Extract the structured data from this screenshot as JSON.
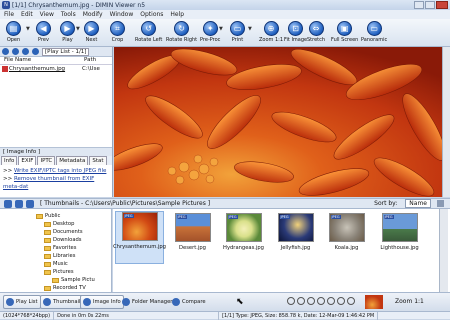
{
  "window": {
    "title": "[1/1] Chrysanthemum.jpg - DIMIN Viewer n5"
  },
  "menu": [
    "File",
    "Edit",
    "View",
    "Tools",
    "Modify",
    "Window",
    "Options",
    "Help"
  ],
  "toolbar": [
    {
      "label": "Open",
      "icon": "folder-icon"
    },
    {
      "label": "Prev",
      "icon": "arrow-left-icon"
    },
    {
      "label": "Play",
      "icon": "play-icon"
    },
    {
      "label": "Next",
      "icon": "arrow-right-icon"
    },
    {
      "label": "Crop",
      "icon": "crop-icon"
    },
    {
      "label": "Rotate Left",
      "icon": "rotate-left-icon"
    },
    {
      "label": "Rotate Right",
      "icon": "rotate-right-icon"
    },
    {
      "label": "Pre-Proc",
      "icon": "preprocess-icon"
    },
    {
      "label": "Print",
      "icon": "print-icon"
    },
    {
      "label": "Zoom 1:1",
      "icon": "zoom-icon"
    },
    {
      "label": "Fit Image",
      "icon": "fit-icon"
    },
    {
      "label": "Stretch",
      "icon": "stretch-icon"
    },
    {
      "label": "Full Screen",
      "icon": "fullscreen-icon"
    },
    {
      "label": "Panoramic",
      "icon": "panoramic-icon"
    }
  ],
  "playlist": {
    "title": "[Play List - 1/1]",
    "col_file": "File Name",
    "col_path": "Path",
    "file": "Chrysanthemum.jpg",
    "path": "C:\\Use"
  },
  "info": {
    "title": "[ Image Info ]",
    "tabs": [
      "Info",
      "EXIF",
      "IPTC",
      "Metadata",
      "Stat"
    ],
    "selected_tab": "EXIF",
    "link1": "Write EXIF/IPTC tags into JPEG file",
    "link2": "Remove thumbnail from EXIF meta-dat"
  },
  "thumbnails": {
    "title": "[ Thumbnails - C:\\Users\\Public\\Pictures\\Sample Pictures ]",
    "sort_label": "Sort by:",
    "sort_value": "Name",
    "items": [
      {
        "name": "Chrysanthemum.jpg",
        "badge": "JPEG"
      },
      {
        "name": "Desert.jpg",
        "badge": "JPEG"
      },
      {
        "name": "Hydrangeas.jpg",
        "badge": "JPEG"
      },
      {
        "name": "Jellyfish.jpg",
        "badge": "JPEG"
      },
      {
        "name": "Koala.jpg",
        "badge": "JPEG"
      },
      {
        "name": "Lighthouse.jpg",
        "badge": "JPEG"
      }
    ]
  },
  "tree": [
    "Public",
    "Desktop",
    "Documents",
    "Downloads",
    "Favorites",
    "Libraries",
    "Music",
    "Pictures",
    "Sample Pictu",
    "Recorded TV"
  ],
  "bottom": {
    "playlist": "Play List",
    "thumbnails": "Thumbnails",
    "image_info": "Image Info",
    "folder_manager": "Folder Manager",
    "compare": "Compare",
    "zoom": "Zoom 1:1"
  },
  "status": {
    "dims": "(1024*768*24bpp)",
    "time": "Done in 0m 0s 22ms",
    "fileinfo": "[1/1] Type: JPEG, Size: 858.78 k, Date: 12-Mar-09 1:46:42 PM"
  }
}
